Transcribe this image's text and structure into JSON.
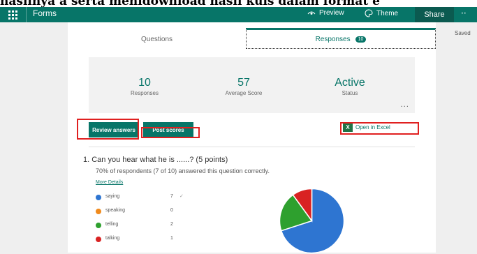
{
  "caption": "hasilnya a serta menidownload hasil kuis dalam format e",
  "header": {
    "app_name": "Forms",
    "preview_label": "Preview",
    "theme_label": "Theme",
    "share_label": "Share",
    "more_label": "··"
  },
  "status": {
    "saved_label": "Saved"
  },
  "tabs": {
    "questions_label": "Questions",
    "responses_label": "Responses",
    "responses_count": "10"
  },
  "stats": [
    {
      "value": "10",
      "label": "Responses"
    },
    {
      "value": "57",
      "label": "Average Score"
    },
    {
      "value": "Active",
      "label": "Status"
    }
  ],
  "more_dots": "...",
  "actions": {
    "review_label": "Review answers",
    "post_label": "Post scores",
    "excel_label": "Open in Excel"
  },
  "question": {
    "title": "1.  Can you hear what he is ......? (5 points)",
    "subtitle": "70% of respondents (7 of 10) answered this question correctly.",
    "more_details": "More Details"
  },
  "options": [
    {
      "label": "saying",
      "count": "7",
      "color": "#2e75d1",
      "check": "✓"
    },
    {
      "label": "speaking",
      "count": "0",
      "color": "#f08a1c",
      "check": ""
    },
    {
      "label": "telling",
      "count": "2",
      "color": "#2ea02e",
      "check": ""
    },
    {
      "label": "talking",
      "count": "1",
      "color": "#d92222",
      "check": ""
    }
  ],
  "colors": {
    "brand": "#077568",
    "highlight": "#e02020"
  },
  "chart_data": {
    "type": "pie",
    "categories": [
      "saying",
      "speaking",
      "telling",
      "talking"
    ],
    "values": [
      7,
      0,
      2,
      1
    ],
    "colors": [
      "#2e75d1",
      "#f08a1c",
      "#2ea02e",
      "#d92222"
    ]
  }
}
